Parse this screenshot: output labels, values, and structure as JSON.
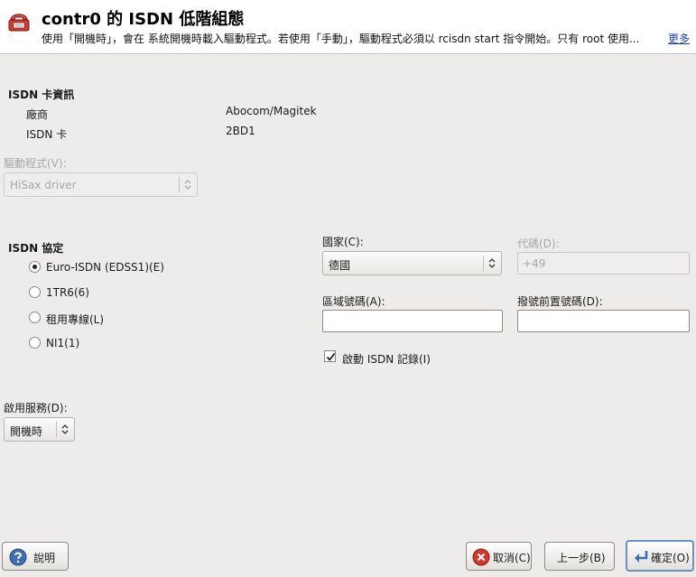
{
  "header": {
    "title": "contr0 的  ISDN 低階組態",
    "description": "使用「開機時」，會在  系統開機時載入驅動程式。若使用「手動」，驅動程式必須以  rcisdn start 指令開始。只有  root 使用...",
    "more_link": "更多"
  },
  "isdn_card": {
    "title": "ISDN 卡資訊",
    "vendor_label": "廠商",
    "vendor_value": "Abocom/Magitek",
    "card_label": "ISDN 卡",
    "card_value": "2BD1"
  },
  "driver": {
    "label": "驅動程式(V):",
    "value": "HiSax driver"
  },
  "protocol": {
    "title": "ISDN 協定",
    "options": [
      {
        "label": "Euro-ISDN (EDSS1)(E)",
        "checked": true
      },
      {
        "label": "1TR6(6)",
        "checked": false
      },
      {
        "label": "租用專線(L)",
        "checked": false
      },
      {
        "label": "NI1(1)",
        "checked": false
      }
    ]
  },
  "country": {
    "label": "國家(C):",
    "value": "德國"
  },
  "code": {
    "label": "代碼(D):",
    "value": "+49"
  },
  "area_code": {
    "label": "區域號碼(A):",
    "value": ""
  },
  "dial_prefix": {
    "label": "撥號前置號碼(D):",
    "value": ""
  },
  "logging": {
    "label": "啟動  ISDN 記錄(I)",
    "checked": true
  },
  "start_service": {
    "label": "啟用服務(D):",
    "value": "開機時"
  },
  "buttons": {
    "help": "說明",
    "abort": "取消(C)",
    "back": "上一步(B)",
    "ok": "確定(O)"
  }
}
